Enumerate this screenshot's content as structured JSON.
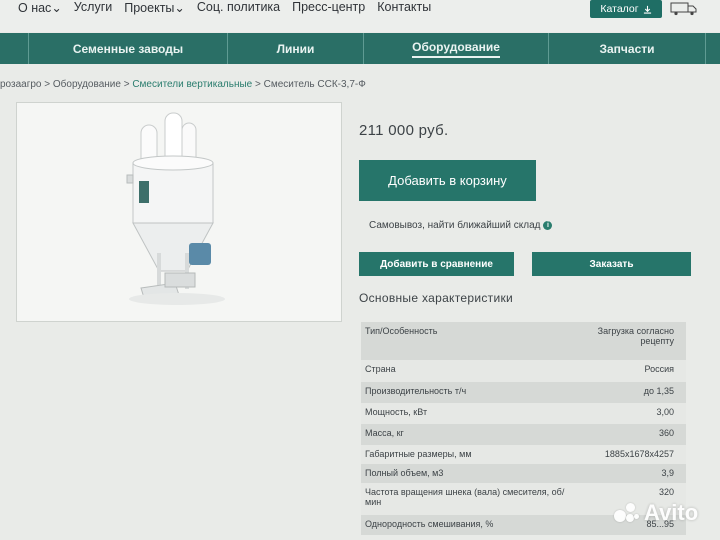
{
  "topnav": {
    "items": [
      "О нас",
      "Услуги",
      "Проекты",
      "Соц. политика",
      "Пресс-центр",
      "Контакты"
    ],
    "catalog_label": "Каталог"
  },
  "mainnav": {
    "items": [
      "Семенные заводы",
      "Линии",
      "Оборудование",
      "Запчасти"
    ],
    "active": "Оборудование"
  },
  "breadcrumb": {
    "items": [
      "розаагро",
      "Оборудование",
      "Смесители вертикальные",
      "Смеситель ССК-3,7-Ф"
    ],
    "separator": ">"
  },
  "product": {
    "price": "211 000 руб.",
    "add_to_cart": "Добавить в корзину",
    "pickup_text": "Самовывоз, найти ближайший склад",
    "compare_label": "Добавить в сравнение",
    "order_label": "Заказать",
    "specs_title": "Основные характеристики",
    "specs": [
      {
        "name": "Тип/Особенность",
        "value": "Загрузка согласно рецепту"
      },
      {
        "name": "Страна",
        "value": "Россия"
      },
      {
        "name": "Производительность т/ч",
        "value": "до 1,35"
      },
      {
        "name": "Мощность, кВт",
        "value": "3,00"
      },
      {
        "name": "Масса, кг",
        "value": "360"
      },
      {
        "name": "Габаритные размеры, мм",
        "value": "1885х1678х4257"
      },
      {
        "name": "Полный объем, м3",
        "value": "3,9"
      },
      {
        "name": "Частота вращения шнека (вала) смесителя, об/мин",
        "value": "320"
      },
      {
        "name": "Однородность смешивания, %",
        "value": "85...95"
      }
    ]
  },
  "watermark": "Avito"
}
